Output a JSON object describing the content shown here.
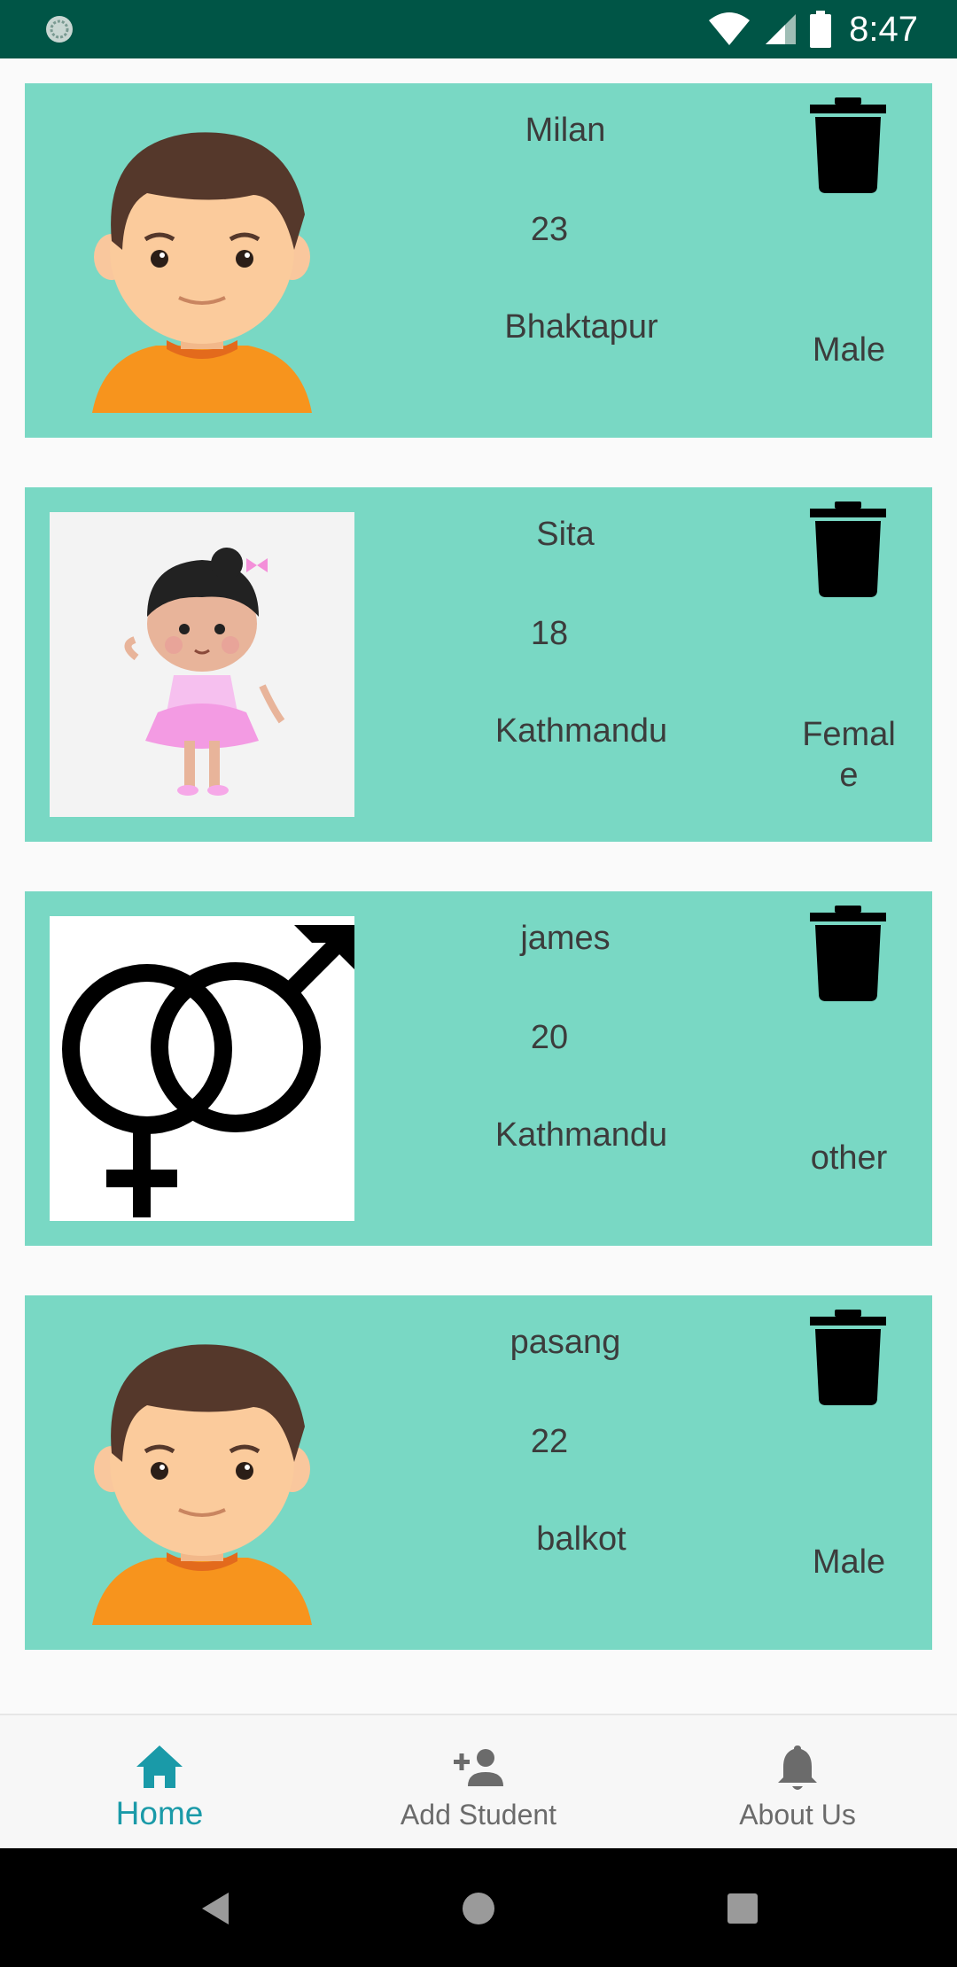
{
  "status_bar": {
    "time": "8:47"
  },
  "students": [
    {
      "name": "Milan",
      "age": "23",
      "address": "Bhaktapur",
      "gender": "Male",
      "avatar": "boy-avatar"
    },
    {
      "name": "Sita",
      "age": "18",
      "address": "Kathmandu",
      "gender": "Female",
      "avatar": "girl-avatar"
    },
    {
      "name": "james",
      "age": "20",
      "address": "Kathmandu",
      "gender": "other",
      "avatar": "gender-symbol"
    },
    {
      "name": "pasang",
      "age": "22",
      "address": "balkot",
      "gender": "Male",
      "avatar": "boy-avatar"
    }
  ],
  "bottom_nav": {
    "home": "Home",
    "add_student": "Add Student",
    "about_us": "About Us"
  },
  "icons": {
    "delete": "trash-icon",
    "home": "home-icon",
    "add_student": "person-add-icon",
    "about_us": "bell-icon"
  },
  "colors": {
    "status_bar": "#005546",
    "card": "#79d8c4",
    "accent": "#1a9aa8"
  }
}
